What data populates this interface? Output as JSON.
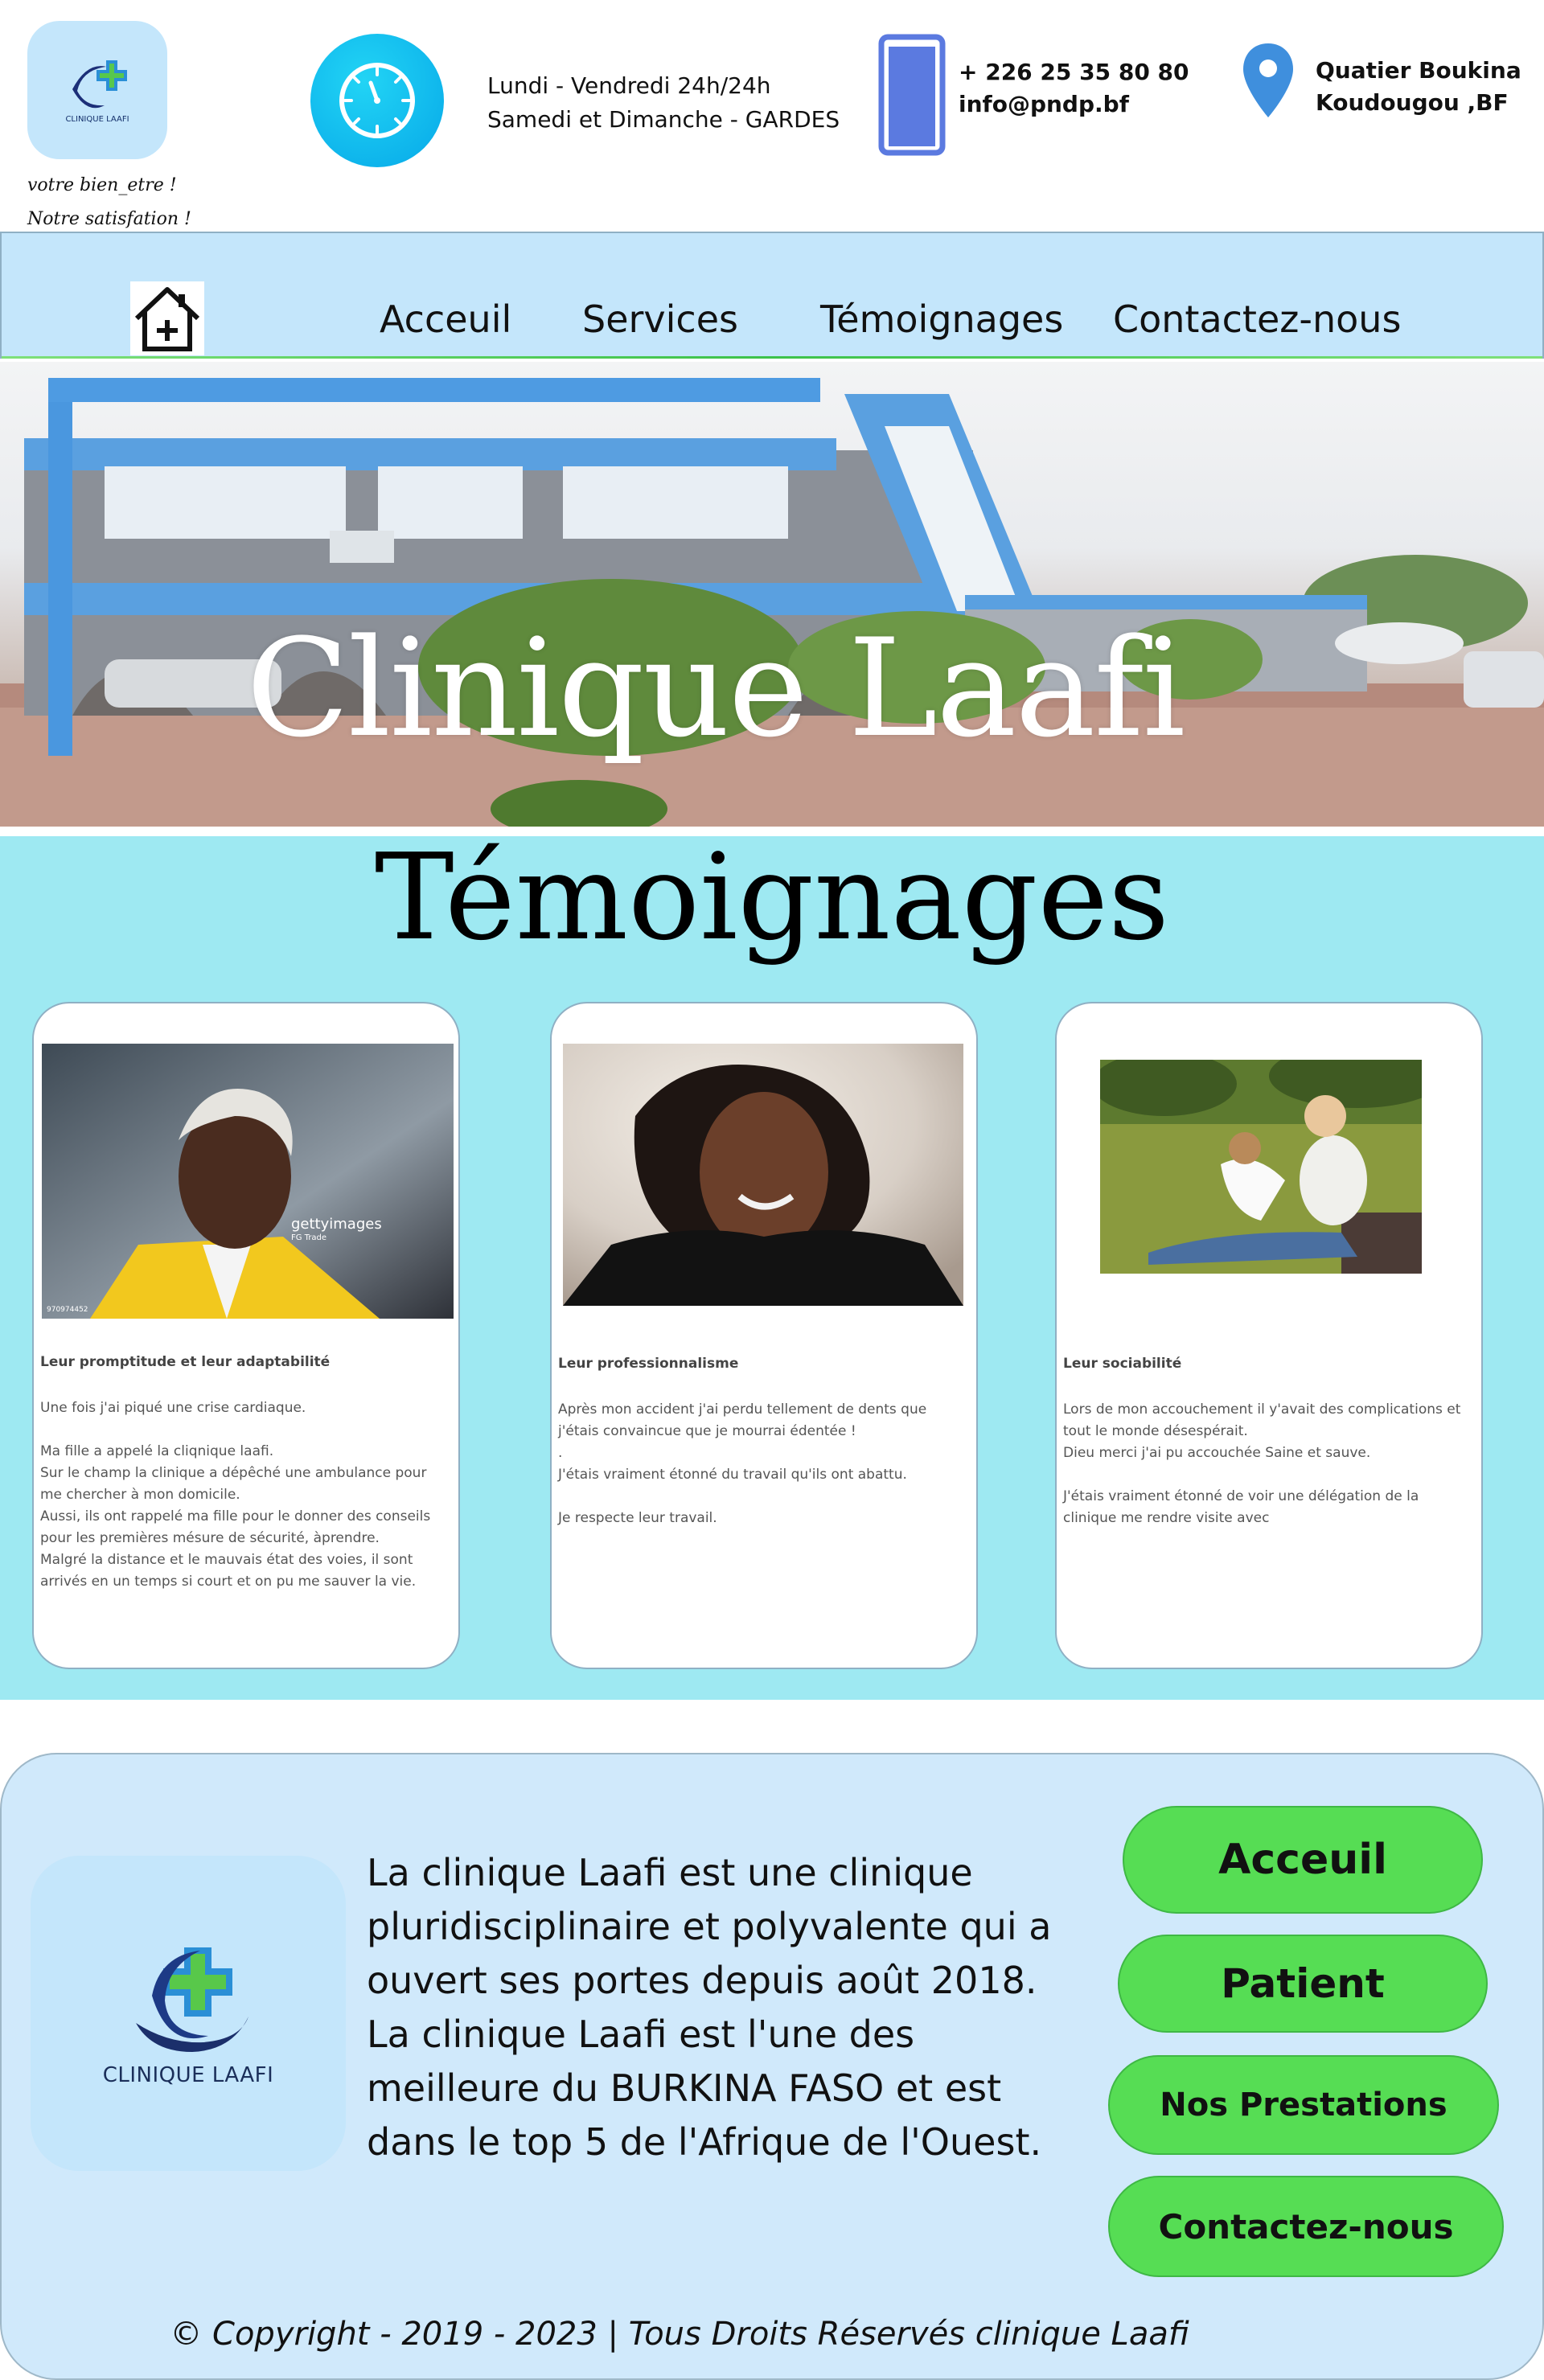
{
  "header": {
    "logo_label": "CLINIQUE LAAFI",
    "slogan_line1": "votre bien_etre !",
    "slogan_line2": "Notre satisfation !",
    "hours_line1": "Lundi - Vendredi 24h/24h",
    "hours_line2": "Samedi et Dimanche - GARDES",
    "phone": "+ 226 25 35 80 80",
    "email": "info@pndp.bf",
    "address_line1": "Quatier Boukina",
    "address_line2": "Koudougou ,BF"
  },
  "nav": {
    "items": [
      {
        "label": "Acceuil"
      },
      {
        "label": "Services"
      },
      {
        "label": "Témoignages"
      },
      {
        "label": "Contactez-nous"
      }
    ]
  },
  "hero": {
    "title": "Clinique Laafi"
  },
  "testimonials": {
    "title": "Témoignages",
    "cards": [
      {
        "title": "Leur promptitude et leur adaptabilité",
        "photo_watermark": "gettyimages",
        "photo_sub": "FG Trade",
        "photo_id": "970974452",
        "paragraphs": [
          "Une fois j'ai piqué une crise cardiaque.",
          "Ma fille a appelé la cliqnique laafi.\nSur le champ la clinique a dépêché une ambulance pour me chercher à mon domicile.\nAussi, ils ont rappelé ma fille pour le donner des conseils pour les premières mésure de sécurité, àprendre.\nMalgré la distance et le mauvais état des voies, il sont arrivés en un temps si court et on pu me sauver la vie."
        ]
      },
      {
        "title": "Leur professionnalisme",
        "paragraphs": [
          "Après mon accident j'ai perdu tellement de dents que j'étais convaincue que je mourrai édentée !\n.\nJ'étais vraiment étonné du travail qu'ils ont abattu.",
          "Je respecte leur travail."
        ]
      },
      {
        "title": "Leur sociabilité",
        "paragraphs": [
          "Lors de mon accouchement il y'avait des complications et tout le monde désespérait.\nDieu merci j'ai pu accouchée Saine et sauve.",
          "J'étais vraiment étonné de voir une délégation de la clinique me rendre visite avec"
        ]
      }
    ]
  },
  "footer": {
    "logo_label": "CLINIQUE LAAFI",
    "description": "La clinique Laafi est une clinique pluridisciplinaire et polyvalente qui a ouvert ses portes depuis août 2018. La clinique Laafi est l'une des meilleure du BURKINA FASO et est dans le top 5 de l'Afrique de l'Ouest.",
    "buttons": {
      "home": "Acceuil",
      "patient": "Patient",
      "services": "Nos Prestations",
      "contact": "Contactez-nous"
    },
    "copyright": "© Copyright - 2019 - 2023 | Tous Droits Réservés clinique Laafi"
  },
  "colors": {
    "light_blue": "#c4e6fb",
    "cyan_section": "#9ee9f2",
    "green_button": "#56dd54",
    "footer_bg": "#d0e9fb"
  },
  "icons": {
    "clock": "clock-icon",
    "phone": "phone-icon",
    "location": "location-pin-icon",
    "home": "home-icon"
  }
}
